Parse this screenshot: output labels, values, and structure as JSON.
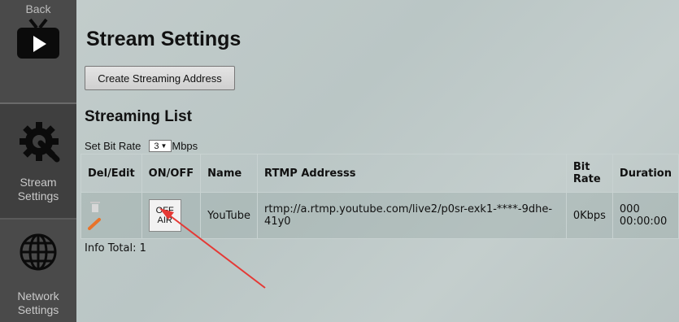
{
  "sidebar": {
    "back_label": "Back",
    "stream_label": [
      "Stream",
      "Settings"
    ],
    "network_label": [
      "Network",
      "Settings"
    ]
  },
  "page": {
    "title": "Stream Settings",
    "create_button": "Create Streaming Address",
    "section_title": "Streaming List",
    "bitrate_label": "Set Bit Rate",
    "bitrate_value": "3",
    "bitrate_unit": "Mbps",
    "info_total": "Info Total: 1"
  },
  "table": {
    "headers": [
      "Del/Edit",
      "ON/OFF",
      "Name",
      "RTMP Addresss",
      [
        "Bit",
        "Rate"
      ],
      "Duration"
    ],
    "rows": [
      {
        "onoff": [
          "OFF",
          "AIR"
        ],
        "name": "YouTube",
        "rtmp": "rtmp://a.rtmp.youtube.com/live2/p0sr-exk1-****-9dhe-41y0",
        "bitrate": "0Kbps",
        "duration": [
          "000",
          "00:00:00"
        ]
      }
    ]
  },
  "colors": {
    "sidebar": "#4a4a4a",
    "accent_arrow": "#e53935",
    "edit_icon": "#e8732a"
  }
}
